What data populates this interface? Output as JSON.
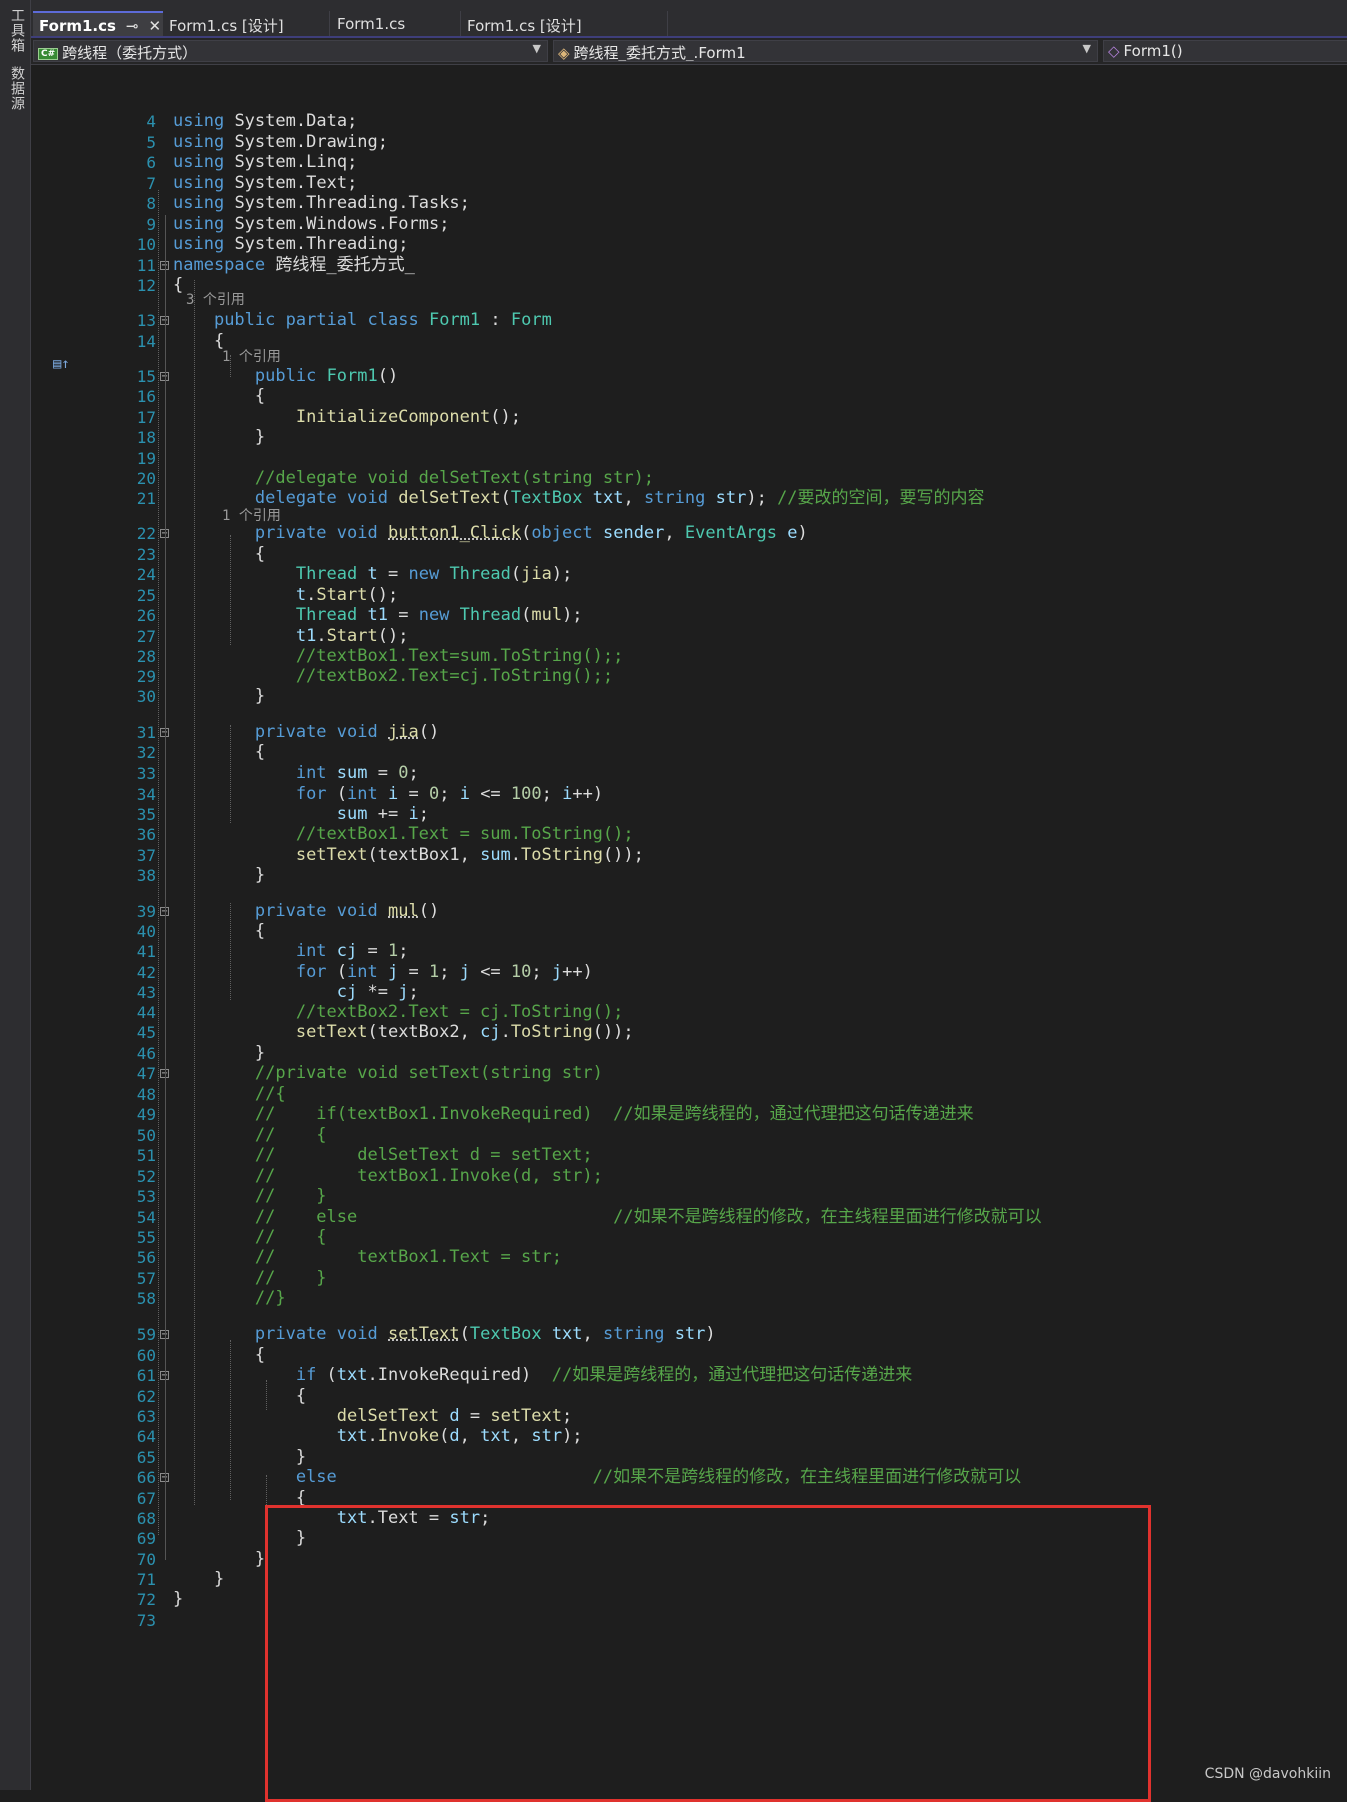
{
  "sidebar": {
    "toolbox_label": "工具箱",
    "datasource_label": "数据源"
  },
  "tabs": [
    {
      "label": "Form1.cs",
      "pin": "⊸",
      "close": "✕"
    },
    {
      "label": "Form1.cs [设计]"
    },
    {
      "label": "Form1.cs"
    },
    {
      "label": "Form1.cs [设计]"
    }
  ],
  "navbar": {
    "project": "跨线程（委托方式）",
    "class": "跨线程_委托方式_.Form1",
    "member": "Form1()",
    "project_icon": "csharp-project-icon",
    "class_icon": "class-icon",
    "member_icon": "method-icon"
  },
  "refs": [
    "3 个引用",
    "1 个引用",
    "1 个引用"
  ],
  "watermark": "CSDN @davohkiin",
  "colors": {
    "keyword": "#569cd6",
    "type": "#4ec9b0",
    "comment": "#57a64a",
    "number": "#b5cea8",
    "method": "#dcdcaa",
    "variable": "#9cdcfe",
    "line_number": "#2b91af",
    "highlight_box": "#e0322e"
  },
  "code_lines": [
    {
      "n": 4,
      "text": "using System.Data;"
    },
    {
      "n": 5,
      "text": "using System.Drawing;"
    },
    {
      "n": 6,
      "text": "using System.Linq;"
    },
    {
      "n": 7,
      "text": "using System.Text;"
    },
    {
      "n": 8,
      "text": "using System.Threading.Tasks;"
    },
    {
      "n": 9,
      "text": "using System.Windows.Forms;"
    },
    {
      "n": 10,
      "text": "using System.Threading;"
    },
    {
      "n": 11,
      "text": "namespace 跨线程_委托方式_"
    },
    {
      "n": 12,
      "text": "{"
    },
    {
      "n": 13,
      "text": "    public partial class Form1 : Form"
    },
    {
      "n": 14,
      "text": "    {"
    },
    {
      "n": 15,
      "text": "        public Form1()"
    },
    {
      "n": 16,
      "text": "        {"
    },
    {
      "n": 17,
      "text": "            InitializeComponent();"
    },
    {
      "n": 18,
      "text": "        }"
    },
    {
      "n": 19,
      "text": ""
    },
    {
      "n": 20,
      "text": "        //delegate void delSetText(string str);"
    },
    {
      "n": 21,
      "text": "        delegate void delSetText(TextBox txt, string str); //要改的空间，要写的内容"
    },
    {
      "n": 22,
      "text": "        private void button1_Click(object sender, EventArgs e)"
    },
    {
      "n": 23,
      "text": "        {"
    },
    {
      "n": 24,
      "text": "            Thread t = new Thread(jia);"
    },
    {
      "n": 25,
      "text": "            t.Start();"
    },
    {
      "n": 26,
      "text": "            Thread t1 = new Thread(mul);"
    },
    {
      "n": 27,
      "text": "            t1.Start();"
    },
    {
      "n": 28,
      "text": "            //textBox1.Text=sum.ToString();;"
    },
    {
      "n": 29,
      "text": "            //textBox2.Text=cj.ToString();;"
    },
    {
      "n": 30,
      "text": "        }"
    },
    {
      "n": 31,
      "text": "        private void jia()"
    },
    {
      "n": 32,
      "text": "        {"
    },
    {
      "n": 33,
      "text": "            int sum = 0;"
    },
    {
      "n": 34,
      "text": "            for (int i = 0; i <= 100; i++)"
    },
    {
      "n": 35,
      "text": "                sum += i;"
    },
    {
      "n": 36,
      "text": "            //textBox1.Text = sum.ToString();"
    },
    {
      "n": 37,
      "text": "            setText(textBox1, sum.ToString());"
    },
    {
      "n": 38,
      "text": "        }"
    },
    {
      "n": 39,
      "text": "        private void mul()"
    },
    {
      "n": 40,
      "text": "        {"
    },
    {
      "n": 41,
      "text": "            int cj = 1;"
    },
    {
      "n": 42,
      "text": "            for (int j = 1; j <= 10; j++)"
    },
    {
      "n": 43,
      "text": "                cj *= j;"
    },
    {
      "n": 44,
      "text": "            //textBox2.Text = cj.ToString();"
    },
    {
      "n": 45,
      "text": "            setText(textBox2, cj.ToString());"
    },
    {
      "n": 46,
      "text": "        }"
    },
    {
      "n": 47,
      "text": "        //private void setText(string str)"
    },
    {
      "n": 48,
      "text": "        //{"
    },
    {
      "n": 49,
      "text": "        //    if(textBox1.InvokeRequired)  //如果是跨线程的，通过代理把这句话传递进来"
    },
    {
      "n": 50,
      "text": "        //    {"
    },
    {
      "n": 51,
      "text": "        //        delSetText d = setText;"
    },
    {
      "n": 52,
      "text": "        //        textBox1.Invoke(d, str);"
    },
    {
      "n": 53,
      "text": "        //    }"
    },
    {
      "n": 54,
      "text": "        //    else                         //如果不是跨线程的修改，在主线程里面进行修改就可以"
    },
    {
      "n": 55,
      "text": "        //    {"
    },
    {
      "n": 56,
      "text": "        //        textBox1.Text = str;"
    },
    {
      "n": 57,
      "text": "        //    }"
    },
    {
      "n": 58,
      "text": "        //}"
    },
    {
      "n": 59,
      "text": "        private void setText(TextBox txt, string str)"
    },
    {
      "n": 60,
      "text": "        {"
    },
    {
      "n": 61,
      "text": "            if (txt.InvokeRequired)  //如果是跨线程的，通过代理把这句话传递进来"
    },
    {
      "n": 62,
      "text": "            {"
    },
    {
      "n": 63,
      "text": "                delSetText d = setText;"
    },
    {
      "n": 64,
      "text": "                txt.Invoke(d, txt, str);"
    },
    {
      "n": 65,
      "text": "            }"
    },
    {
      "n": 66,
      "text": "            else                         //如果不是跨线程的修改，在主线程里面进行修改就可以"
    },
    {
      "n": 67,
      "text": "            {"
    },
    {
      "n": 68,
      "text": "                txt.Text = str;"
    },
    {
      "n": 69,
      "text": "            }"
    },
    {
      "n": 70,
      "text": "        }"
    },
    {
      "n": 71,
      "text": "    }"
    },
    {
      "n": 72,
      "text": "}"
    },
    {
      "n": 73,
      "text": ""
    }
  ]
}
